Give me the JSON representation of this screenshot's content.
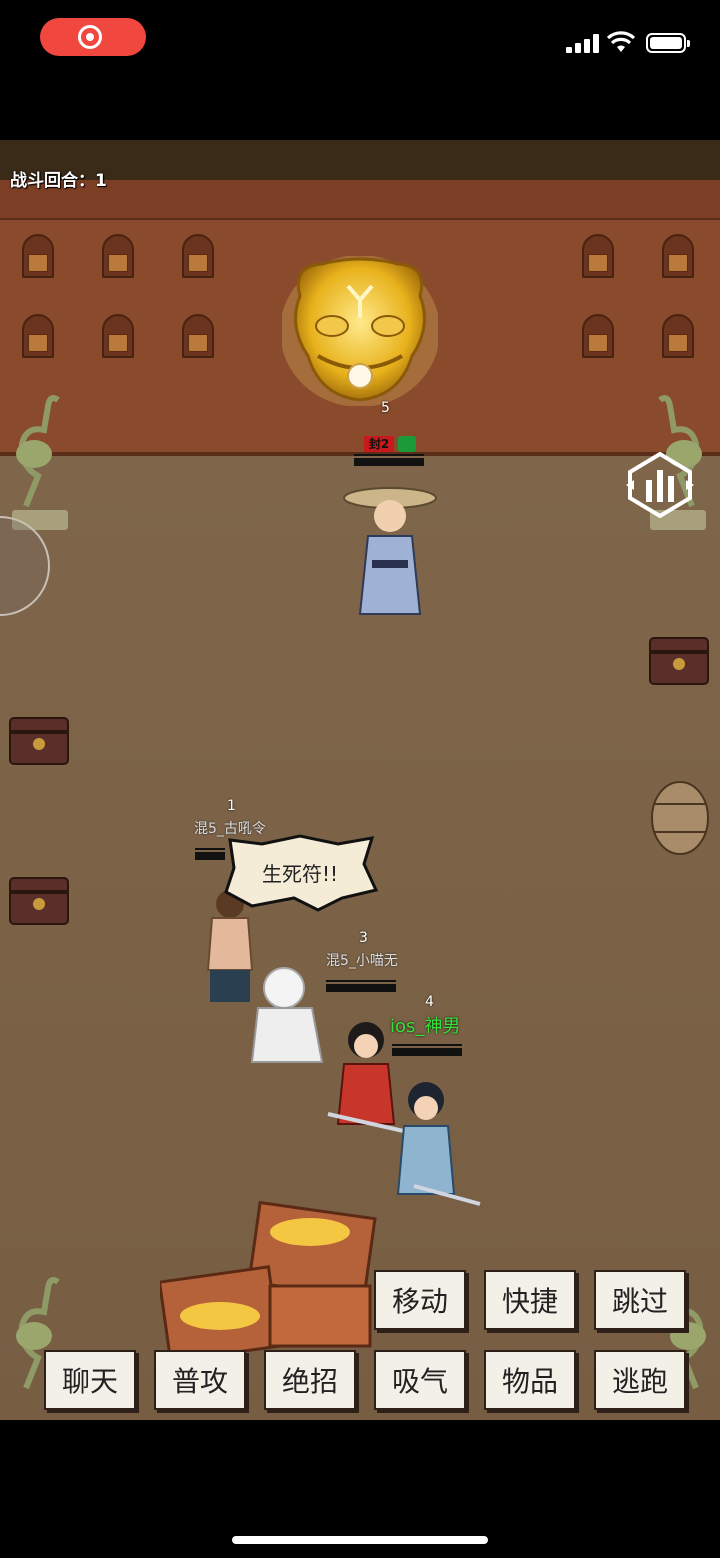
{
  "battle": {
    "round_label": "战斗回合：1"
  },
  "enemy": {
    "boss_number": "5",
    "status_seal": "封2"
  },
  "party": [
    {
      "number": "1",
      "name": "混5_古吼令"
    },
    {
      "number": "3",
      "name": "混5_小喵无"
    },
    {
      "number": "4",
      "name": "ios_神男"
    }
  ],
  "speech_bubble": "生死符!!",
  "actions_top": [
    "移动",
    "快捷",
    "跳过"
  ],
  "actions_bottom": [
    "聊天",
    "普攻",
    "绝招",
    "吸气",
    "物品",
    "逃跑"
  ],
  "colors": {
    "record_pill": "#f0483e",
    "player_name": "#34e23a",
    "button_bg": "#f3f0e8"
  }
}
